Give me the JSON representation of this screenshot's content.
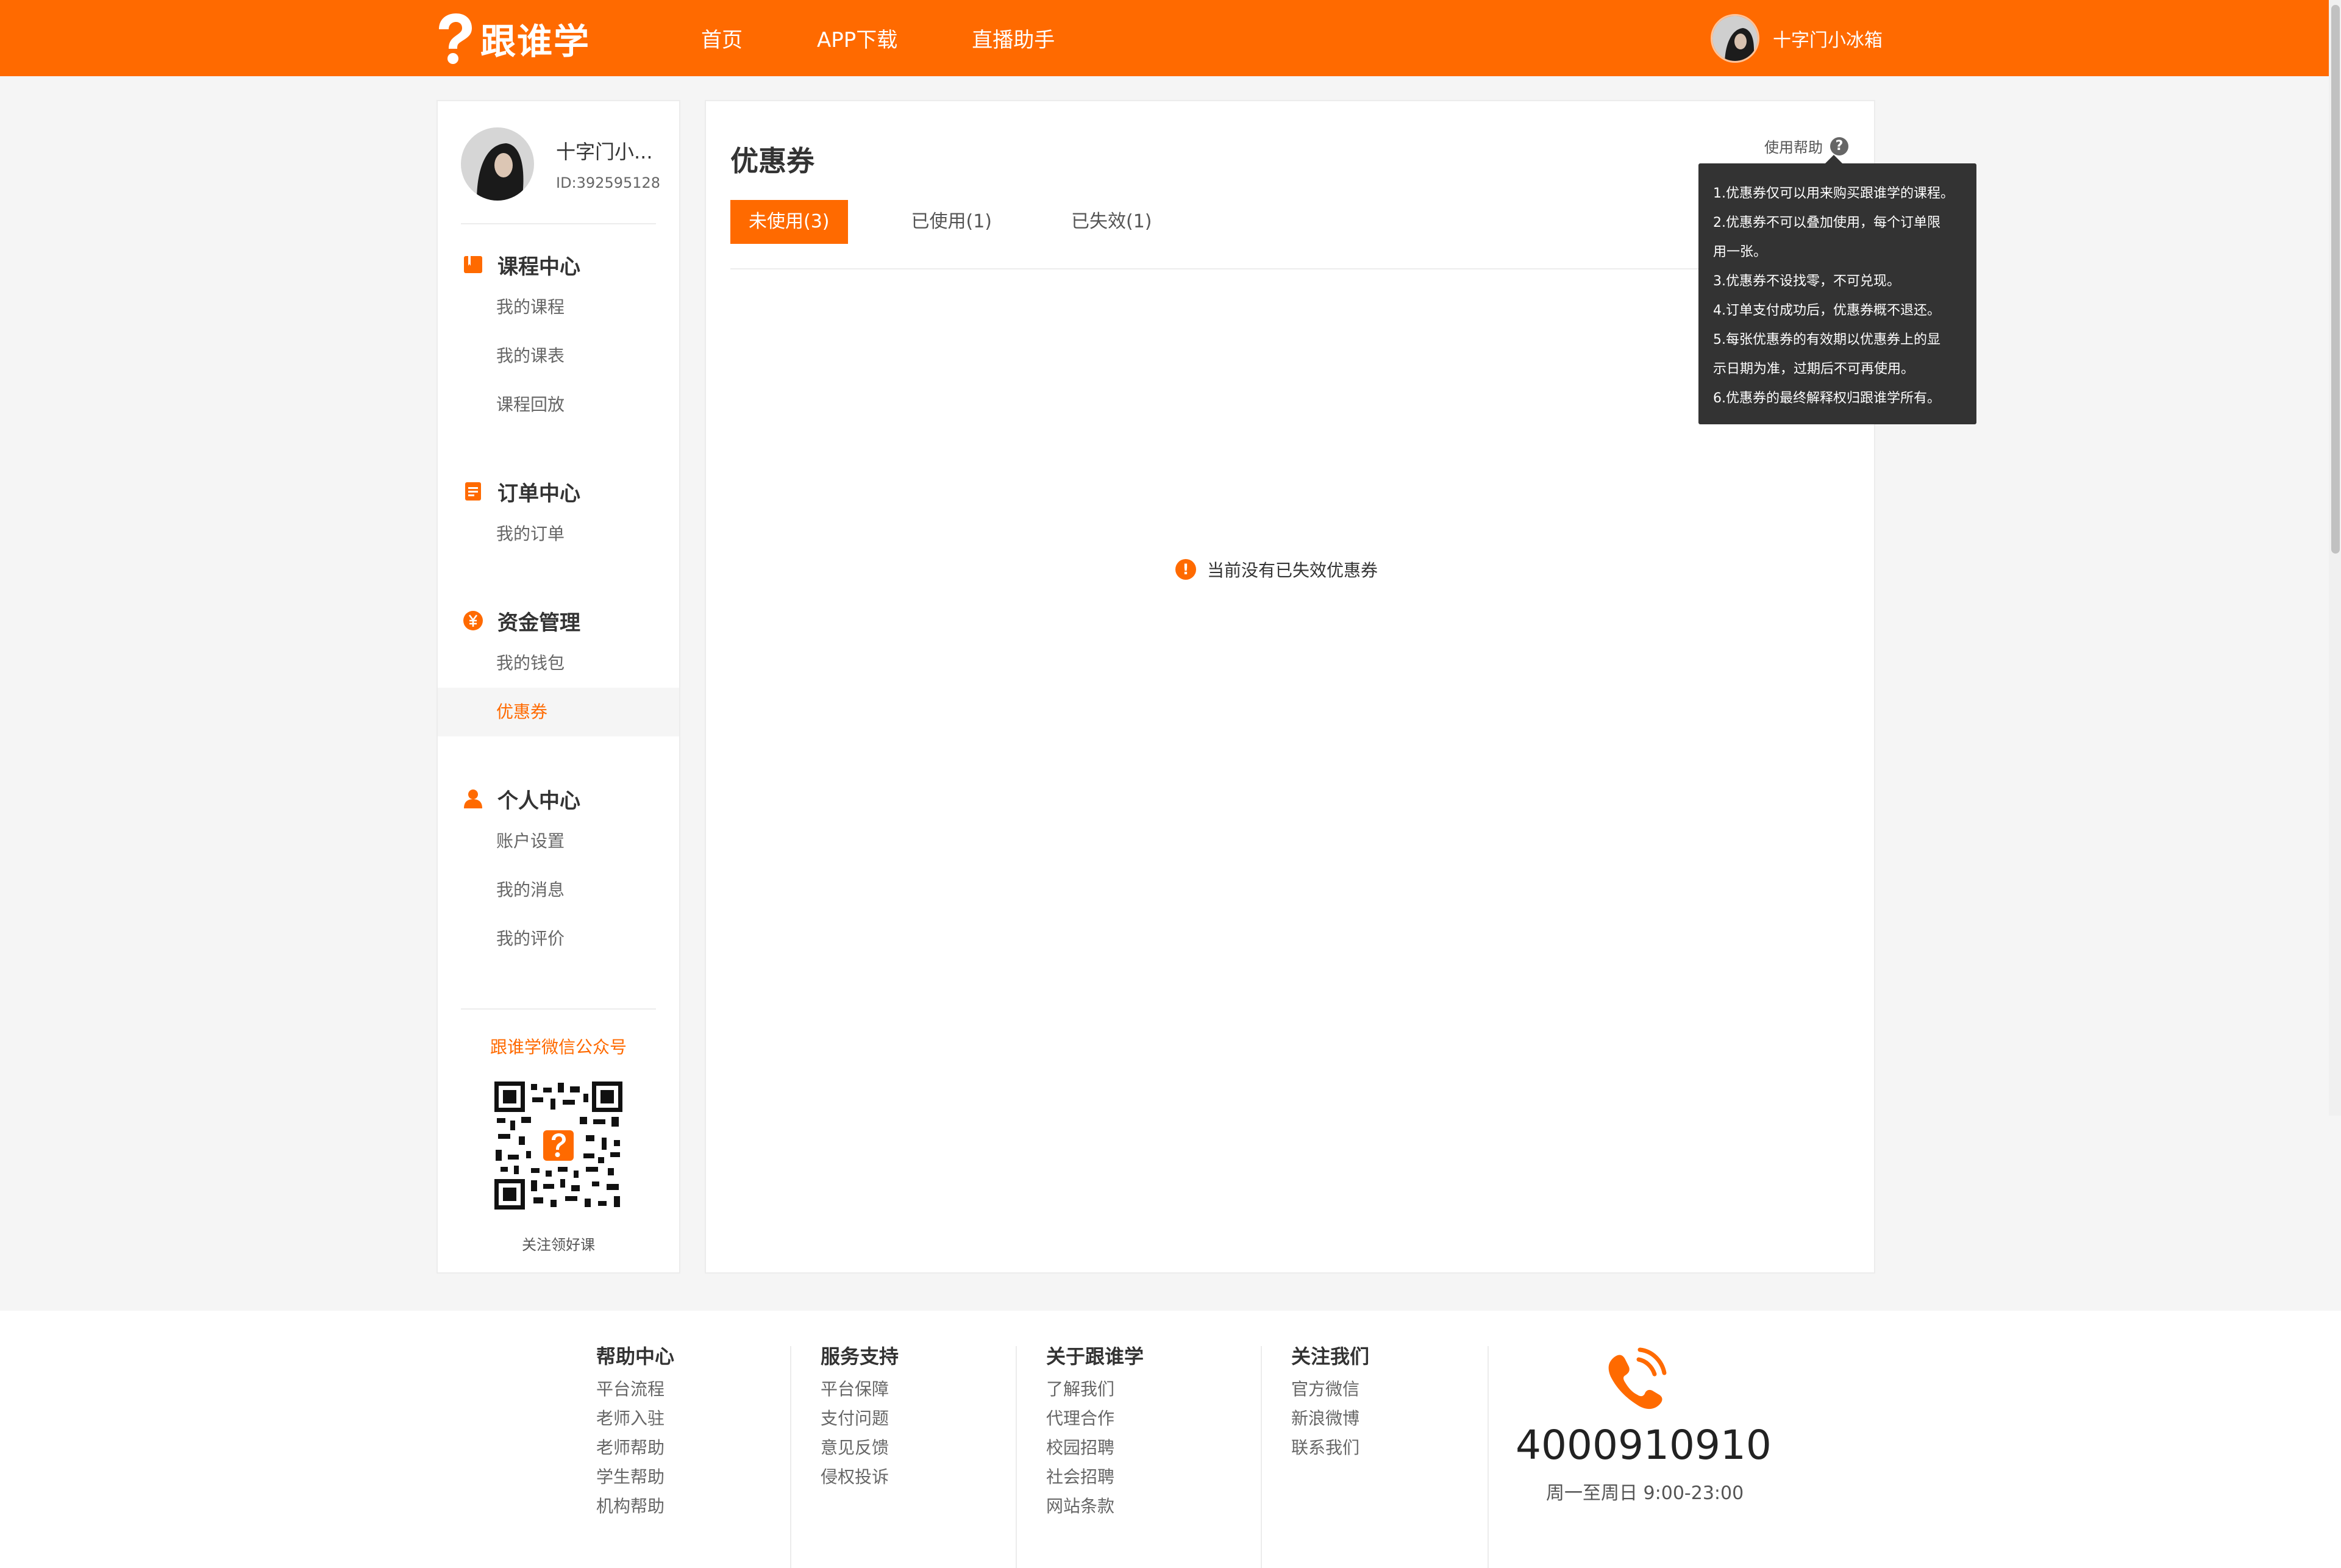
{
  "header": {
    "logo_text": "跟谁学",
    "nav": [
      "首页",
      "APP下载",
      "直播助手"
    ],
    "user_name": "十字门小冰箱"
  },
  "profile": {
    "name": "十字门小...",
    "id": "ID:392595128"
  },
  "sidebar": {
    "groups": [
      {
        "title": "课程中心",
        "icon": "book-icon",
        "items": [
          "我的课程",
          "我的课表",
          "课程回放"
        ]
      },
      {
        "title": "订单中心",
        "icon": "document-icon",
        "items": [
          "我的订单"
        ]
      },
      {
        "title": "资金管理",
        "icon": "money-icon",
        "items": [
          "我的钱包",
          "优惠券"
        ]
      },
      {
        "title": "个人中心",
        "icon": "person-icon",
        "items": [
          "账户设置",
          "我的消息",
          "我的评价"
        ]
      }
    ],
    "active_item": "优惠券",
    "qr_title": "跟谁学微信公众号",
    "qr_caption": "关注领好课"
  },
  "main": {
    "title": "优惠券",
    "help_label": "使用帮助",
    "help_icon": "?",
    "tabs": [
      "未使用(3)",
      "已使用(1)",
      "已失效(1)"
    ],
    "active_tab": "未使用(3)",
    "empty_icon": "!",
    "empty_text": "当前没有已失效优惠券",
    "tooltip": [
      "1.优惠券仅可以用来购买跟谁学的课程。",
      "2.优惠券不可以叠加使用，每个订单限",
      "用一张。",
      "3.优惠券不设找零，不可兑现。",
      "4.订单支付成功后，优惠券概不退还。",
      "5.每张优惠券的有效期以优惠券上的显",
      "示日期为准，过期后不可再使用。",
      "6.优惠券的最终解释权归跟谁学所有。"
    ]
  },
  "footer": {
    "columns": [
      {
        "title": "帮助中心",
        "links": [
          "平台流程",
          "老师入驻",
          "老师帮助",
          "学生帮助",
          "机构帮助"
        ]
      },
      {
        "title": "服务支持",
        "links": [
          "平台保障",
          "支付问题",
          "意见反馈",
          "侵权投诉"
        ]
      },
      {
        "title": "关于跟谁学",
        "links": [
          "了解我们",
          "代理合作",
          "校园招聘",
          "社会招聘",
          "网站条款"
        ]
      },
      {
        "title": "关注我们",
        "links": [
          "官方微信",
          "新浪微博",
          "联系我们"
        ]
      }
    ],
    "phone": "4000910910",
    "hours": "周一至周日 9:00-23:00"
  },
  "colors": {
    "brand": "#ff6a00",
    "tooltip_bg": "#333333",
    "page_bg": "#f5f5f5"
  }
}
